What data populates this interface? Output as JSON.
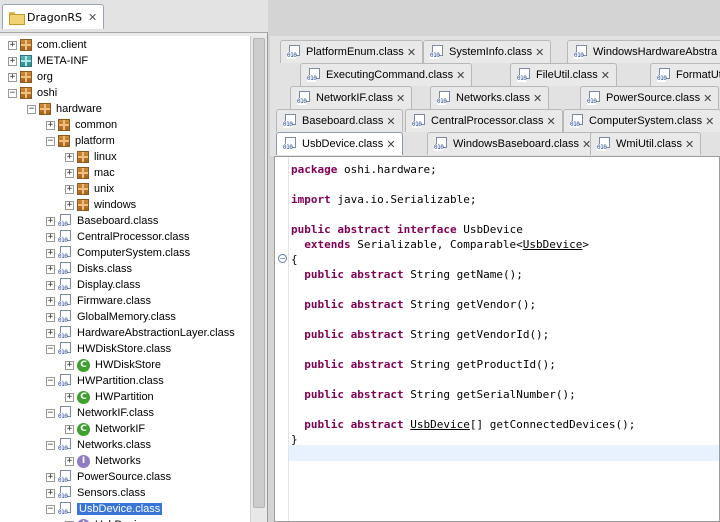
{
  "left_panel": {
    "tab": {
      "label": "DragonRS",
      "close": "✕"
    },
    "tree": [
      {
        "label": "com.client",
        "icon": "package-icon",
        "toggle": "+",
        "depth": 0
      },
      {
        "label": "META-INF",
        "icon": "folder-package-icon",
        "toggle": "+",
        "depth": 0
      },
      {
        "label": "org",
        "icon": "package-icon",
        "toggle": "+",
        "depth": 0
      },
      {
        "label": "oshi",
        "icon": "package-icon",
        "toggle": "−",
        "depth": 0
      },
      {
        "label": "hardware",
        "icon": "package-icon",
        "toggle": "−",
        "depth": 1
      },
      {
        "label": "common",
        "icon": "package-icon",
        "toggle": "+",
        "depth": 2
      },
      {
        "label": "platform",
        "icon": "package-icon",
        "toggle": "−",
        "depth": 2
      },
      {
        "label": "linux",
        "icon": "package-icon",
        "toggle": "+",
        "depth": 3
      },
      {
        "label": "mac",
        "icon": "package-icon",
        "toggle": "+",
        "depth": 3
      },
      {
        "label": "unix",
        "icon": "package-icon",
        "toggle": "+",
        "depth": 3
      },
      {
        "label": "windows",
        "icon": "package-icon",
        "toggle": "+",
        "depth": 3
      },
      {
        "label": "Baseboard.class",
        "icon": "class-file-icon",
        "toggle": "+",
        "depth": 2
      },
      {
        "label": "CentralProcessor.class",
        "icon": "class-file-icon",
        "toggle": "+",
        "depth": 2
      },
      {
        "label": "ComputerSystem.class",
        "icon": "class-file-icon",
        "toggle": "+",
        "depth": 2
      },
      {
        "label": "Disks.class",
        "icon": "class-file-icon",
        "toggle": "+",
        "depth": 2
      },
      {
        "label": "Display.class",
        "icon": "class-file-icon",
        "toggle": "+",
        "depth": 2
      },
      {
        "label": "Firmware.class",
        "icon": "class-file-icon",
        "toggle": "+",
        "depth": 2
      },
      {
        "label": "GlobalMemory.class",
        "icon": "class-file-icon",
        "toggle": "+",
        "depth": 2
      },
      {
        "label": "HardwareAbstractionLayer.class",
        "icon": "class-file-icon",
        "toggle": "+",
        "depth": 2
      },
      {
        "label": "HWDiskStore.class",
        "icon": "class-file-icon",
        "toggle": "−",
        "depth": 2
      },
      {
        "label": "HWDiskStore",
        "icon": "class-icon",
        "toggle": "+",
        "depth": 3
      },
      {
        "label": "HWPartition.class",
        "icon": "class-file-icon",
        "toggle": "−",
        "depth": 2
      },
      {
        "label": "HWPartition",
        "icon": "class-icon",
        "toggle": "+",
        "depth": 3
      },
      {
        "label": "NetworkIF.class",
        "icon": "class-file-icon",
        "toggle": "−",
        "depth": 2
      },
      {
        "label": "NetworkIF",
        "icon": "class-icon",
        "toggle": "+",
        "depth": 3
      },
      {
        "label": "Networks.class",
        "icon": "class-file-icon",
        "toggle": "−",
        "depth": 2
      },
      {
        "label": "Networks",
        "icon": "interface-icon",
        "toggle": "+",
        "depth": 3
      },
      {
        "label": "PowerSource.class",
        "icon": "class-file-icon",
        "toggle": "+",
        "depth": 2
      },
      {
        "label": "Sensors.class",
        "icon": "class-file-icon",
        "toggle": "+",
        "depth": 2
      },
      {
        "label": "UsbDevice.class",
        "icon": "class-file-icon",
        "toggle": "−",
        "depth": 2,
        "selected": true
      },
      {
        "label": "UsbDevice",
        "icon": "interface-icon",
        "toggle": "+",
        "depth": 3
      }
    ]
  },
  "editor_tabs": [
    {
      "label": "PlatformEnum.class"
    },
    {
      "label": "SystemInfo.class"
    },
    {
      "label": "WindowsHardwareAbstra"
    },
    {
      "label": "ExecutingCommand.class"
    },
    {
      "label": "FileUtil.class"
    },
    {
      "label": "FormatUtil"
    },
    {
      "label": "NetworkIF.class"
    },
    {
      "label": "Networks.class"
    },
    {
      "label": "PowerSource.class"
    },
    {
      "label": "Baseboard.class"
    },
    {
      "label": "CentralProcessor.class"
    },
    {
      "label": "ComputerSystem.class"
    },
    {
      "label": "UsbDevice.class",
      "active": true
    },
    {
      "label": "WindowsBaseboard.class"
    },
    {
      "label": "WmiUtil.class"
    }
  ],
  "tab_close": "✕",
  "class_icon_glyph": "C",
  "interface_icon_glyph": "I",
  "class_file_bits": "010",
  "code": [
    [
      {
        "t": "package",
        "k": 1
      },
      {
        "t": " oshi.hardware;"
      }
    ],
    [],
    [
      {
        "t": "import",
        "k": 1
      },
      {
        "t": " java.io.Serializable;"
      }
    ],
    [],
    [
      {
        "t": "public",
        "k": 1
      },
      {
        "t": " "
      },
      {
        "t": "abstract",
        "k": 1
      },
      {
        "t": " "
      },
      {
        "t": "interface",
        "k": 1
      },
      {
        "t": " UsbDevice"
      }
    ],
    [
      {
        "t": "  "
      },
      {
        "t": "extends",
        "k": 1
      },
      {
        "t": " Serializable, Comparable<"
      },
      {
        "t": "UsbDevice",
        "u": 1
      },
      {
        "t": ">"
      }
    ],
    [
      {
        "t": "{"
      }
    ],
    [
      {
        "t": "  "
      },
      {
        "t": "public",
        "k": 1
      },
      {
        "t": " "
      },
      {
        "t": "abstract",
        "k": 1
      },
      {
        "t": " String getName();"
      }
    ],
    [],
    [
      {
        "t": "  "
      },
      {
        "t": "public",
        "k": 1
      },
      {
        "t": " "
      },
      {
        "t": "abstract",
        "k": 1
      },
      {
        "t": " String getVendor();"
      }
    ],
    [],
    [
      {
        "t": "  "
      },
      {
        "t": "public",
        "k": 1
      },
      {
        "t": " "
      },
      {
        "t": "abstract",
        "k": 1
      },
      {
        "t": " String getVendorId();"
      }
    ],
    [],
    [
      {
        "t": "  "
      },
      {
        "t": "public",
        "k": 1
      },
      {
        "t": " "
      },
      {
        "t": "abstract",
        "k": 1
      },
      {
        "t": " String getProductId();"
      }
    ],
    [],
    [
      {
        "t": "  "
      },
      {
        "t": "public",
        "k": 1
      },
      {
        "t": " "
      },
      {
        "t": "abstract",
        "k": 1
      },
      {
        "t": " String getSerialNumber();"
      }
    ],
    [],
    [
      {
        "t": "  "
      },
      {
        "t": "public",
        "k": 1
      },
      {
        "t": " "
      },
      {
        "t": "abstract",
        "k": 1
      },
      {
        "t": " "
      },
      {
        "t": "UsbDevice",
        "u": 1
      },
      {
        "t": "[] getConnectedDevices();"
      }
    ],
    [
      {
        "t": "}"
      }
    ]
  ],
  "fold_marker": "−"
}
